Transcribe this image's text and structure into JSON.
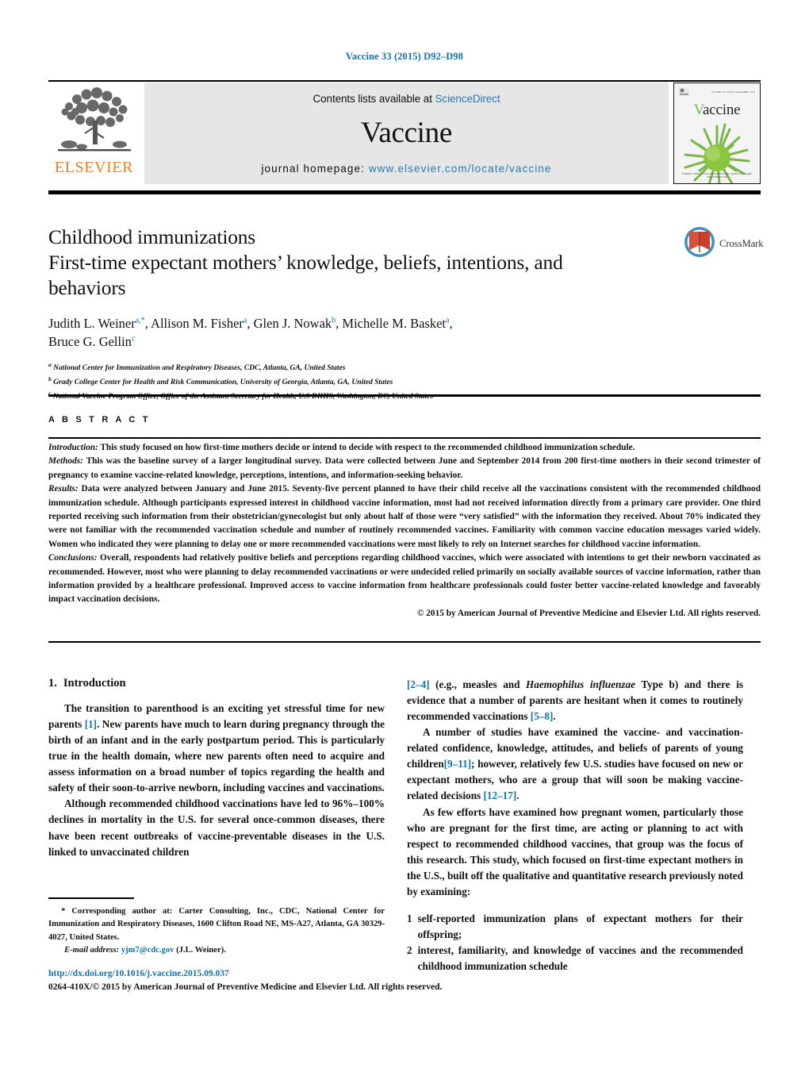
{
  "running_head": "Vaccine 33 (2015) D92–D98",
  "masthead": {
    "publisher_name": "ELSEVIER",
    "contents_prefix": "Contents lists available at ",
    "contents_link": "ScienceDirect",
    "journal_name": "Vaccine",
    "homepage_prefix": "journal homepage: ",
    "homepage_url": "www.elsevier.com/locate/vaccine",
    "cover": {
      "title_first_letter": "V",
      "title_rest": "accine",
      "top_left_label": "ELSEVIER",
      "top_right_label": "VOLUME 33, ISSUE D   DECEMBER 2015",
      "footer_label": "Available online at www.sciencedirect.com  •  journal homepage: www.elsevier.com"
    }
  },
  "article": {
    "title_line1": "Childhood immunizations",
    "title_line2": "First-time expectant mothers’ knowledge, beliefs, intentions, and",
    "title_line3": "behaviors",
    "authors": [
      {
        "name": "Judith L. Weiner",
        "marks": "a,*",
        "sep": ", "
      },
      {
        "name": "Allison M. Fisher",
        "marks": "a",
        "sep": ", "
      },
      {
        "name": "Glen J. Nowak",
        "marks": "b",
        "sep": ", "
      },
      {
        "name": "Michelle M. Basket",
        "marks": "a",
        "sep": ", "
      },
      {
        "name": "Bruce G. Gellin",
        "marks": "c",
        "sep": ""
      }
    ],
    "affiliations": [
      {
        "mark": "a",
        "text": "National Center for Immunization and Respiratory Diseases, CDC, Atlanta, GA, United States"
      },
      {
        "mark": "b",
        "text": "Grady College Center for Health and Risk Communication, University of Georgia, Atlanta, GA, United States"
      },
      {
        "mark": "c",
        "text": "National Vaccine Program Office, Office of the Assistant Secretary for Health, U.S DHHS, Washington, DC, United States"
      }
    ],
    "crossmark_label": "CrossMark"
  },
  "abstract": {
    "heading": "A B S T R A C T",
    "introduction_label": "Introduction:",
    "introduction_text": " This study focused on how first-time mothers decide or intend to decide with respect to the recommended childhood immunization schedule.",
    "methods_label": "Methods:",
    "methods_text": " This was the baseline survey of a larger longitudinal survey. Data were collected between June and September 2014 from 200 first-time mothers in their second trimester of pregnancy to examine vaccine-related knowledge, perceptions, intentions, and information-seeking behavior.",
    "results_label": "Results:",
    "results_text": " Data were analyzed between January and June 2015. Seventy-five percent planned to have their child receive all the vaccinations consistent with the recommended childhood immunization schedule. Although participants expressed interest in childhood vaccine information, most had not received information directly from a primary care provider. One third reported receiving such information from their obstetrician/gynecologist but only about half of those were “very satisfied” with the information they received. About 70% indicated they were not familiar with the recommended vaccination schedule and number of routinely recommended vaccines. Familiarity with common vaccine education messages varied widely. Women who indicated they were planning to delay one or more recommended vaccinations were most likely to rely on Internet searches for childhood vaccine information.",
    "conclusions_label": "Conclusions:",
    "conclusions_text": " Overall, respondents had relatively positive beliefs and perceptions regarding childhood vaccines, which were associated with intentions to get their newborn vaccinated as recommended. However, most who were planning to delay recommended vaccinations or were undecided relied primarily on socially available sources of vaccine information, rather than information provided by a healthcare professional. Improved access to vaccine information from healthcare professionals could foster better vaccine-related knowledge and favorably impact vaccination decisions.",
    "copyright": "© 2015 by American Journal of Preventive Medicine and Elsevier Ltd. All rights reserved."
  },
  "introduction": {
    "section_number": "1.",
    "section_title": "Introduction",
    "para1_a": "The transition to parenthood is an exciting yet stressful time for new parents ",
    "para1_ref": "[1]",
    "para1_b": ". New parents have much to learn during pregnancy through the birth of an infant and in the early postpartum period. This is particularly true in the health domain, where new parents often need to acquire and assess information on a broad number of topics regarding the health and safety of their soon-to-arrive newborn, including vaccines and vaccinations.",
    "para2": "Although recommended childhood vaccinations have led to 96%–100% declines in mortality in the U.S. for several once-common diseases, there have been recent outbreaks of vaccine-preventable diseases in the U.S. linked to unvaccinated children",
    "para2_ref": "[2–4]",
    "para2_b": " (e.g., measles and ",
    "para2_ital": "Haemophilus influenzae",
    "para2_c": " Type b) and there is evidence that a number of parents are hesitant when it comes to routinely recommended vaccinations ",
    "para2_ref2": "[5–8]",
    "para2_d": ".",
    "para3_a": "A number of studies have examined the vaccine- and vaccination-related confidence, knowledge, attitudes, and beliefs of parents of young children",
    "para3_ref": "[9–11]",
    "para3_b": "; however, relatively few U.S. studies have focused on new or expectant mothers, who are a group that will soon be making vaccine-related decisions ",
    "para3_ref2": "[12–17]",
    "para3_c": ".",
    "para4": "As few efforts have examined how pregnant women, particularly those who are pregnant for the first time, are acting or planning to act with respect to recommended childhood vaccines, that group was the focus of this research. This study, which focused on first-time expectant mothers in the U.S., built off the qualitative and quantitative research previously noted by examining:",
    "list": [
      {
        "number": "1",
        "text": "self-reported immunization plans of expectant mothers for their offspring;"
      },
      {
        "number": "2",
        "text": "interest, familiarity, and knowledge of vaccines and the recommended childhood immunization schedule"
      }
    ]
  },
  "footnote": {
    "corresponding_marker": "*",
    "corresponding_text": " Corresponding author at: Carter Consulting, Inc., CDC, National Center for Immunization and Respiratory Diseases, 1600 Clifton Road NE, MS-A27, Atlanta, GA 30329-4027, United States.",
    "email_label": "E-mail address:",
    "email_address": "yjm7@cdc.gov",
    "email_suffix": " (J.L. Weiner).",
    "doi": "http://dx.doi.org/10.1016/j.vaccine.2015.09.037",
    "issn_line": "0264-410X/© 2015 by American Journal of Preventive Medicine and Elsevier Ltd. All rights reserved."
  },
  "colors": {
    "link_blue": "#1271a8",
    "sciencedirect_blue": "#2a7ab0",
    "elsevier_orange": "#ef7d22",
    "masthead_grey": "#e6e6e6",
    "cover_green": "#7ab648",
    "crossmark_red": "#c9402e",
    "crossmark_blue": "#3e8fc4"
  }
}
